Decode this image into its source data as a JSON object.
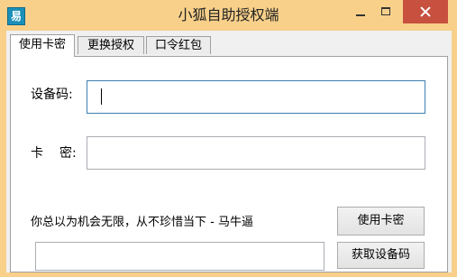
{
  "window": {
    "title": "小狐自助授权端",
    "icon_glyph": "易",
    "colors": {
      "frame": "#f8d08a",
      "close_button": "#c7503f",
      "focus_border": "#3c7fb1"
    }
  },
  "tabs": [
    {
      "label": "使用卡密",
      "active": true
    },
    {
      "label": "更换授权",
      "active": false
    },
    {
      "label": "口令红包",
      "active": false
    }
  ],
  "form": {
    "device_code_label": "设备码:",
    "device_code_value": "",
    "card_key_label_left": "卡",
    "card_key_label_right": "密:",
    "card_key_value": ""
  },
  "footer": {
    "quote": "你总以为机会无限，从不珍惜当下 - 马牛逼",
    "use_card_button": "使用卡密",
    "get_device_code_button": "获取设备码",
    "bottom_field_value": ""
  }
}
